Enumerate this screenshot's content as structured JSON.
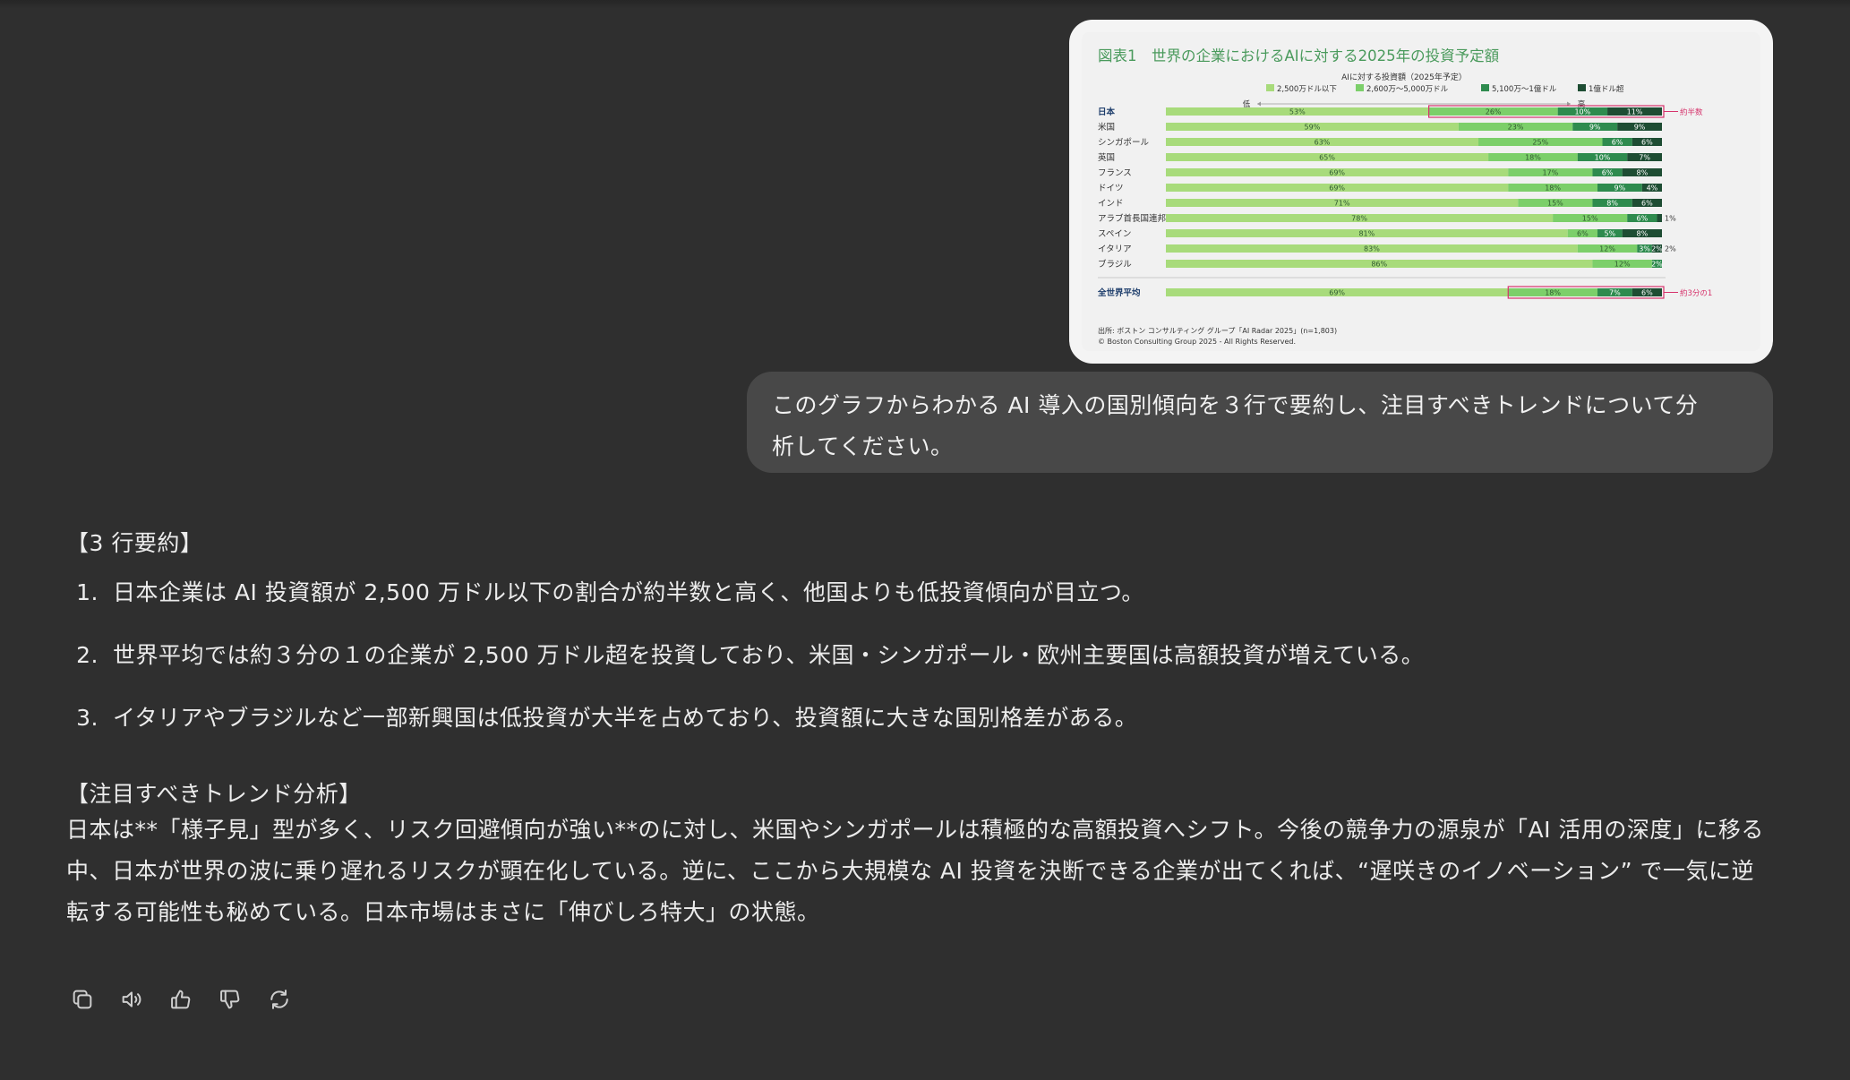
{
  "chart_data": {
    "type": "bar",
    "stacked": true,
    "orientation": "horizontal",
    "title": "図表1　世界の企業におけるAIに対する2025年の投資予定額",
    "legend_title": "AIに対する投資額（2025年予定）",
    "axis_low_label": "低",
    "axis_high_label": "高",
    "legend": [
      {
        "name": "2,500万ドル以下",
        "color": "#a8db7b"
      },
      {
        "name": "2,600万～5,000万ドル",
        "color": "#7ccf6a"
      },
      {
        "name": "5,100万～1億ドル",
        "color": "#2e8b4e"
      },
      {
        "name": "1億ドル超",
        "color": "#1e4d33"
      }
    ],
    "categories": [
      "日本",
      "米国",
      "シンガポール",
      "英国",
      "フランス",
      "ドイツ",
      "インド",
      "アラブ首長国連邦",
      "スペイン",
      "イタリア",
      "ブラジル"
    ],
    "series": [
      {
        "name": "2,500万ドル以下",
        "values": [
          53,
          59,
          63,
          65,
          69,
          69,
          71,
          78,
          81,
          83,
          86
        ]
      },
      {
        "name": "2,600万～5,000万ドル",
        "values": [
          26,
          23,
          25,
          18,
          17,
          18,
          15,
          15,
          6,
          12,
          12
        ]
      },
      {
        "name": "5,100万～1億ドル",
        "values": [
          10,
          9,
          6,
          10,
          6,
          9,
          8,
          6,
          5,
          3,
          2
        ]
      },
      {
        "name": "1億ドル超",
        "values": [
          11,
          9,
          6,
          7,
          8,
          4,
          6,
          1,
          8,
          2,
          0
        ]
      }
    ],
    "outside_labels": [
      "",
      "",
      "",
      "",
      "",
      "",
      "",
      "1%",
      "",
      "2%",
      ""
    ],
    "average": {
      "label": "全世界平均",
      "values": [
        69,
        18,
        7,
        6
      ]
    },
    "annotations": [
      "約半数",
      "約3分の1"
    ],
    "source": "出所: ボストン コンサルティング グループ「AI Radar 2025」(n=1,803)",
    "copyright": "© Boston Consulting Group 2025 - All Rights Reserved."
  },
  "user_message": {
    "line1": "このグラフからわかる AI 導入の国別傾向を３行で要約し、注目すべきトレンドについて分",
    "line2": "析してください。"
  },
  "response": {
    "summary_heading": "【3 行要約】",
    "items": [
      {
        "num": "1.",
        "text": "日本企業は AI 投資額が 2,500 万ドル以下の割合が約半数と高く、他国よりも低投資傾向が目立つ。"
      },
      {
        "num": "2.",
        "text": "世界平均では約３分の１の企業が 2,500 万ドル超を投資しており、米国・シンガポール・欧州主要国は高額投資が増えている。"
      },
      {
        "num": "3.",
        "text": "イタリアやブラジルなど一部新興国は低投資が大半を占めており、投資額に大きな国別格差がある。"
      }
    ],
    "analysis_heading": "【注目すべきトレンド分析】",
    "analysis_line1": "日本は**「様子見」型が多く、リスク回避傾向が強い**のに対し、米国やシンガポールは積極的な高額投資へシフト。今後の競争力の源泉が「AI 活用の深度」に移る",
    "analysis_line2": "中、日本が世界の波に乗り遅れるリスクが顕在化している。逆に、ここから大規模な AI 投資を決断できる企業が出てくれば、“遅咲きのイノベーション” で一気に逆",
    "analysis_line3": "転する可能性も秘めている。日本市場はまさに「伸びしろ特大」の状態。"
  },
  "actions": [
    "copy-icon",
    "speaker-icon",
    "thumbs-up-icon",
    "thumbs-down-icon",
    "regenerate-icon"
  ]
}
